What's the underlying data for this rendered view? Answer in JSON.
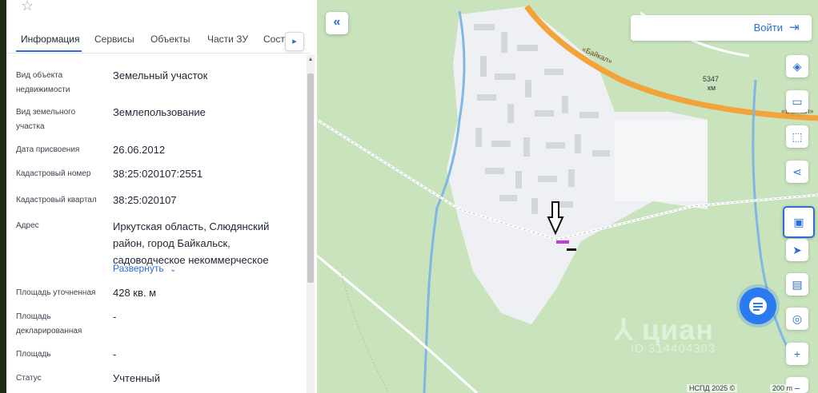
{
  "panel": {
    "tabs": [
      {
        "label": "Информация"
      },
      {
        "label": "Сервисы"
      },
      {
        "label": "Объекты"
      },
      {
        "label": "Части ЗУ"
      },
      {
        "label": "Сост"
      }
    ],
    "tab_scroll_icon": "chevron-right-icon",
    "rows": [
      {
        "label": "Вид объекта недвижимости",
        "value": "Земельный участок"
      },
      {
        "label": "Вид земельного участка",
        "value": "Землепользование"
      },
      {
        "label": "Дата присвоения",
        "value": "26.06.2012"
      },
      {
        "label": "Кадастровый номер",
        "value": "38:25:020107:2551"
      },
      {
        "label": "Кадастровый квартал",
        "value": "38:25:020107"
      },
      {
        "label": "Адрес",
        "value": "Иркутская область, Слюдянский район, город Байкальск, садоводческое некоммерческое"
      },
      {
        "label": "Площадь уточненная",
        "value": "428 кв. м"
      },
      {
        "label": "Площадь декларированная",
        "value": "-"
      },
      {
        "label": "Площадь",
        "value": "-"
      },
      {
        "label": "Статус",
        "value": "Учтенный"
      }
    ],
    "expand_label": "Развернуть"
  },
  "map": {
    "login_label": "Войти",
    "road_label_1": "«Байкал»",
    "road_label_2": "«Байкал»",
    "km_label_num": "5347",
    "km_label_unit": "км",
    "watermark_brand": "циан",
    "watermark_id": "ID 314404393",
    "attribution": "НСПД 2025 ©",
    "scale_label": "200 m",
    "controls": [
      {
        "icon": "layers-icon"
      },
      {
        "icon": "ruler-icon"
      },
      {
        "icon": "select-area-icon"
      },
      {
        "icon": "share-icon"
      },
      {
        "icon": "cadastre-icon"
      },
      {
        "icon": "locate-icon"
      },
      {
        "icon": "panel-icon"
      },
      {
        "icon": "pin-icon"
      },
      {
        "icon": "zoom-in-icon"
      }
    ]
  },
  "colors": {
    "accent": "#2b6fd6",
    "forest": "#c9e3bd",
    "urban": "#eef0f3",
    "road": "#f2a33a",
    "river": "#7fb7e6"
  }
}
